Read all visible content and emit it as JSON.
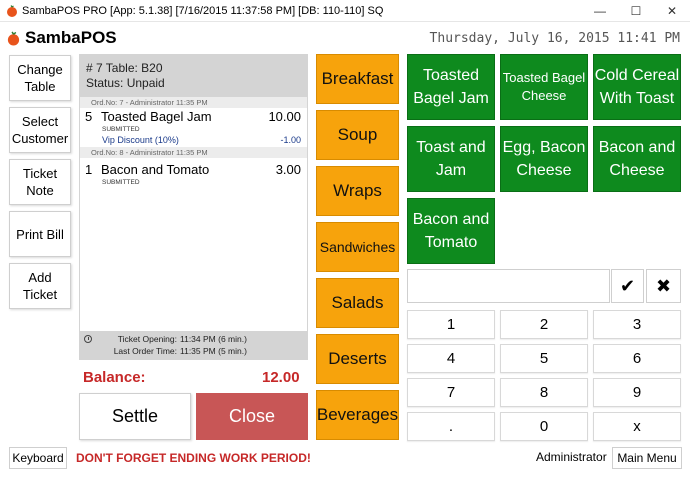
{
  "window": {
    "title": "SambaPOS PRO [App: 5.1.38] [7/16/2015 11:37:58 PM] [DB: 110-110] SQ",
    "minimize_glyph": "—",
    "maximize_glyph": "☐",
    "close_glyph": "✕",
    "icon": "tomato-icon"
  },
  "brand": {
    "name": "SambaPOS",
    "logo_color": "#e8541c"
  },
  "datetime": "Thursday, July 16, 2015 11:41 PM",
  "commands": [
    {
      "label": "Change Table"
    },
    {
      "label": "Select Customer"
    },
    {
      "label": "Ticket Note"
    },
    {
      "label": "Print Bill"
    },
    {
      "label": "Add Ticket"
    }
  ],
  "ticket": {
    "header_line1": "# 7 Table: B20",
    "header_line2": "Status: Unpaid",
    "orders": [
      {
        "meta": "Ord.No: 7 - Administrator 11:35 PM",
        "qty": "5",
        "name": "Toasted Bagel Jam",
        "price": "10.00",
        "state": "SUBMITTED",
        "discount_name": "Vip Discount (10%)",
        "discount_value": "-1.00"
      },
      {
        "meta": "Ord.No: 8 - Administrator 11:35 PM",
        "qty": "1",
        "name": "Bacon and Tomato",
        "price": "3.00",
        "state": "SUBMITTED"
      }
    ],
    "opening_label": "Ticket Opening:",
    "opening_value": "11:34 PM (6 min.)",
    "last_order_label": "Last Order Time:",
    "last_order_value": "11:35 PM (5 min.)"
  },
  "balance": {
    "label": "Balance:",
    "value": "12.00",
    "color": "#c62828"
  },
  "actions": {
    "settle": "Settle",
    "close": "Close",
    "close_color": "#c85656"
  },
  "categories": [
    {
      "label": "Breakfast"
    },
    {
      "label": "Soup"
    },
    {
      "label": "Wraps"
    },
    {
      "label": "Sandwiches"
    },
    {
      "label": "Salads"
    },
    {
      "label": "Deserts"
    },
    {
      "label": "Beverages"
    }
  ],
  "category_color": "#f7a30c",
  "menu_items": [
    {
      "label": "Toasted Bagel Jam"
    },
    {
      "label": "Toasted Bagel Cheese"
    },
    {
      "label": "Cold Cereal With Toast"
    },
    {
      "label": "Toast and Jam"
    },
    {
      "label": "Egg, Bacon Cheese"
    },
    {
      "label": "Bacon and Cheese"
    },
    {
      "label": "Bacon and Tomato"
    }
  ],
  "menu_item_color": "#0e8a1e",
  "numpad": {
    "ok_glyph": "✔",
    "clear_glyph": "✖",
    "keys": [
      "1",
      "2",
      "3",
      "4",
      "5",
      "6",
      "7",
      "8",
      "9",
      ".",
      "0",
      "x"
    ]
  },
  "footer": {
    "keyboard": "Keyboard",
    "warning": "DON'T FORGET ENDING WORK PERIOD!",
    "user": "Administrator",
    "main_menu": "Main Menu"
  }
}
